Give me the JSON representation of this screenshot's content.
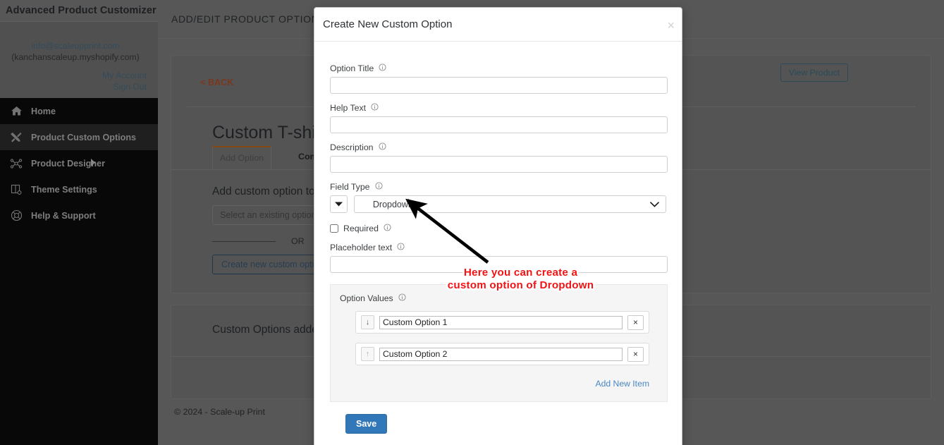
{
  "sidebar": {
    "brand": "Advanced Product Customizer",
    "account": {
      "email": "info@scaleupprint.com",
      "shop": "(kanchanscaleup.myshopify.com)",
      "my_account": "My Account",
      "sign_out": "Sign Out"
    },
    "items": [
      {
        "label": "Home",
        "icon": "home-icon",
        "active": false
      },
      {
        "label": "Product Custom Options",
        "icon": "tools-icon",
        "active": true
      },
      {
        "label": "Product Designer",
        "icon": "nodes-icon",
        "active": false,
        "caret": true
      },
      {
        "label": "Theme Settings",
        "icon": "theme-icon",
        "active": false
      },
      {
        "label": "Help & Support",
        "icon": "lifebuoy-icon",
        "active": false
      }
    ]
  },
  "topbar": {
    "title": "ADD/EDIT PRODUCT OPTIONS"
  },
  "page": {
    "back_label": "< BACK",
    "view_product_label": "View Product",
    "product_title": "Custom T-shirt",
    "tabs": [
      {
        "label": "Add Option",
        "active": true
      },
      {
        "label": "Conditional Logi",
        "active": false,
        "bold": true
      }
    ],
    "add_section_title": "Add custom option to th",
    "select_existing_placeholder": "Select an existing option",
    "or_label": "OR",
    "create_new_label": "Create new custom option",
    "added_title": "Custom Options added to \"C",
    "footer": "© 2024 - Scale-up Print"
  },
  "modal": {
    "title": "Create New Custom Option",
    "close_label": "×",
    "fields": {
      "option_title": {
        "label": "Option Title",
        "value": "",
        "placeholder": ""
      },
      "help_text": {
        "label": "Help Text",
        "value": "",
        "placeholder": ""
      },
      "description": {
        "label": "Description",
        "value": "",
        "placeholder": ""
      },
      "field_type": {
        "label": "Field Type",
        "value": "Dropdown"
      },
      "required": {
        "label": "Required",
        "checked": false
      },
      "placeholder_text": {
        "label": "Placeholder text",
        "value": "",
        "placeholder": ""
      }
    },
    "option_values": {
      "label": "Option Values",
      "rows": [
        {
          "move_icon": "↓",
          "value": "Custom Option 1",
          "delete_label": "×"
        },
        {
          "move_icon": "↑",
          "value": "Custom Option 2",
          "delete_label": "×"
        }
      ],
      "add_new_label": "Add New Item"
    },
    "save_label": "Save"
  },
  "annotation": {
    "text": "Here you can create a custom option of Dropdown",
    "color": "#f01414"
  },
  "colors": {
    "accent_blue": "#3278b8",
    "link_blue": "#4a86c4",
    "sidebar_dark": "#0d0d0d",
    "tab_active": "#c2701f",
    "annotation_red": "#f01414"
  }
}
